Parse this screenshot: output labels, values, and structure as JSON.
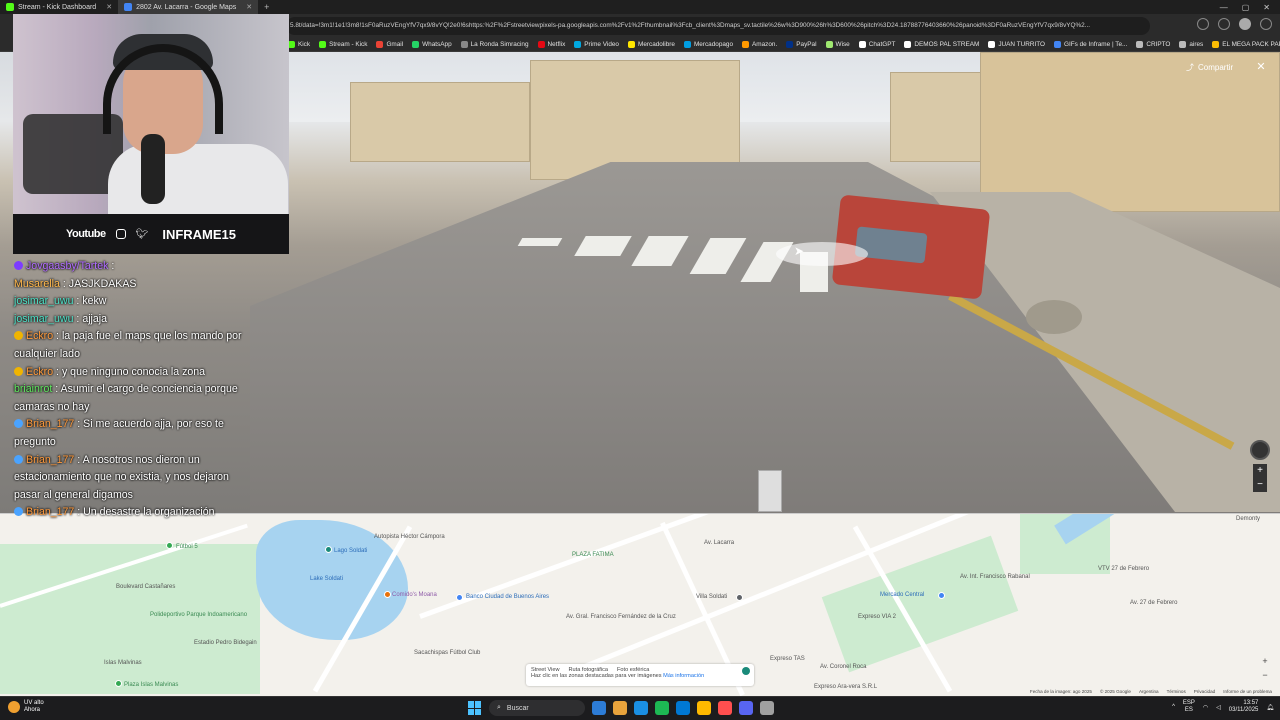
{
  "browser": {
    "tabs": [
      {
        "label": "Stream - Kick Dashboard",
        "color": "#53fc18",
        "active": false
      },
      {
        "label": "2802 Av. Lacarra - Google Maps",
        "color": "#4285f4",
        "active": true
      }
    ],
    "new_tab": "+",
    "url": "5.8t/data=!3m1!1e1!3m8!1sF0aRuzVEngYfV7qx9/8vYQ!2e0!6shttps:%2F%2Fstreetviewpixels-pa.googleapis.com%2Fv1%2Fthumbnail%3Fcb_client%3Dmaps_sv.tactile%26w%3D900%26h%3D600%26pitch%3D24.18788776403660%26panoid%3DF0aRuzVEngYfV7qx9/8vYQ%2...",
    "bookmarks": [
      {
        "label": "Kick",
        "color": "#53fc18"
      },
      {
        "label": "Stream - Kick",
        "color": "#53fc18"
      },
      {
        "label": "Gmail",
        "color": "#ea4335"
      },
      {
        "label": "WhatsApp",
        "color": "#25d366"
      },
      {
        "label": "La Ronda Simracing",
        "color": "#888888"
      },
      {
        "label": "Netflix",
        "color": "#e50914"
      },
      {
        "label": "Prime Video",
        "color": "#00a8e1"
      },
      {
        "label": "Mercadolibre",
        "color": "#ffe600"
      },
      {
        "label": "Mercadopago",
        "color": "#009ee3"
      },
      {
        "label": "Amazon.",
        "color": "#ff9900"
      },
      {
        "label": "PayPal",
        "color": "#003087"
      },
      {
        "label": "Wise",
        "color": "#9fe870"
      },
      {
        "label": "ChatGPT",
        "color": "#ffffff"
      },
      {
        "label": "DEMOS PAL STREAM",
        "color": "#ffffff"
      },
      {
        "label": "JUAN TURRITO",
        "color": "#ffffff"
      },
      {
        "label": "GIFs de Inframe | Te...",
        "color": "#4285f4"
      },
      {
        "label": "CRIPTO",
        "color": "#bbbbbb"
      },
      {
        "label": "aires",
        "color": "#bbbbbb"
      },
      {
        "label": "EL MEGA PACK PAP...",
        "color": "#fbbc04"
      }
    ]
  },
  "streetview": {
    "share_label": "Compartir",
    "close_glyph": "✕",
    "zoom_in": "+",
    "zoom_out": "−"
  },
  "overlay": {
    "social_youtube": "Youtube",
    "handle": "INFRAME15"
  },
  "chat": [
    {
      "user": "Jovgaasby/Tartek",
      "text": "",
      "color": "#b06cff",
      "badge": "#7d3cff"
    },
    {
      "user": "Musarella",
      "text": "JASJKDAKAS",
      "color": "#ffb84d",
      "badge": ""
    },
    {
      "user": "josimar_uwu",
      "text": "kekw",
      "color": "#4de2c8",
      "badge": ""
    },
    {
      "user": "josimar_uwu",
      "text": "ajjaja",
      "color": "#4de2c8",
      "badge": ""
    },
    {
      "user": "Eckro",
      "text": "la paja fue el maps que los mando por cualquier lado",
      "color": "#ff9a3c",
      "badge": "#f0b400"
    },
    {
      "user": "Eckro",
      "text": "y que ninguno conocia la zona",
      "color": "#ff9a3c",
      "badge": "#f0b400"
    },
    {
      "user": "briainrot",
      "text": "Asumir el cargo de conciencia porque camaras no hay",
      "color": "#5fe85f",
      "badge": ""
    },
    {
      "user": "Brian_177",
      "text": "Si me acuerdo ajja, por eso te pregunto",
      "color": "#ff9a3c",
      "badge": "#4aa3ff"
    },
    {
      "user": "Brian_177",
      "text": "A nosotros nos dieron un estacionamiento que no existia, y nos dejaron pasar al general digamos",
      "color": "#ff9a3c",
      "badge": "#4aa3ff"
    },
    {
      "user": "Brian_177",
      "text": "Un desastre la organización",
      "color": "#ff9a3c",
      "badge": "#4aa3ff"
    }
  ],
  "map": {
    "labels": [
      {
        "text": "Lago Soldati",
        "cls": "blue"
      },
      {
        "text": "Lake Soldati",
        "cls": "blue"
      },
      {
        "text": "Fútbol 5",
        "cls": "green"
      },
      {
        "text": "Boulevard Castañares",
        "cls": ""
      },
      {
        "text": "Polideportivo Parque Indoamericano",
        "cls": "green"
      },
      {
        "text": "Estadio Pedro Bidegain",
        "cls": ""
      },
      {
        "text": "Islas Malvinas",
        "cls": ""
      },
      {
        "text": "Plaza Islas Malvinas",
        "cls": "green"
      },
      {
        "text": "Comido's Moana",
        "cls": "purple"
      },
      {
        "text": "Banco Ciudad de Buenos Aires",
        "cls": "blue"
      },
      {
        "text": "Sacachispas Fútbol Club",
        "cls": ""
      },
      {
        "text": "PLAZA FATIMA",
        "cls": "green"
      },
      {
        "text": "Villa Soldati",
        "cls": ""
      },
      {
        "text": "Mercado Central",
        "cls": "blue"
      },
      {
        "text": "Expreso VIA 2",
        "cls": ""
      },
      {
        "text": "Expreso TAS",
        "cls": ""
      },
      {
        "text": "Expreso Ara-vera S.R.L",
        "cls": ""
      },
      {
        "text": "VTV 27 de Febrero",
        "cls": ""
      },
      {
        "text": "Av. 27 de Febrero",
        "cls": ""
      },
      {
        "text": "Av. Coronel Roca",
        "cls": ""
      },
      {
        "text": "Av. Lacarra",
        "cls": ""
      },
      {
        "text": "Av. Int. Francisco Rabanal",
        "cls": ""
      },
      {
        "text": "Autopista Héctor Cámpora",
        "cls": ""
      },
      {
        "text": "Av. Gral. Francisco Fernández de la Cruz",
        "cls": ""
      },
      {
        "text": "Demonty",
        "cls": ""
      }
    ],
    "legend": {
      "street_view": "Street View",
      "photo_route": "Ruta fotográfica",
      "spherical": "Foto esférica",
      "hint": "Haz clic en las zonas destacadas para ver imágenes",
      "more_info": "Más información"
    },
    "footer": [
      "Fecha de la imagen: ago 2025",
      "© 2025 Google",
      "Argentina",
      "Términos",
      "Privacidad",
      "Informe de un problema"
    ],
    "zoom_in": "+",
    "zoom_out": "−"
  },
  "taskbar": {
    "weather_title": "UV alto",
    "weather_sub": "Ahora",
    "search_placeholder": "Buscar",
    "lang_top": "ESP",
    "lang_bottom": "ES",
    "time": "13:57",
    "date": "03/11/2025",
    "apps": [
      "#2d7cd6",
      "#e8a33c",
      "#1a8fe3",
      "#1db954",
      "#0078d4",
      "#ffb900",
      "#ff4f4f",
      "#5865f2",
      "#a0a0a0"
    ]
  }
}
